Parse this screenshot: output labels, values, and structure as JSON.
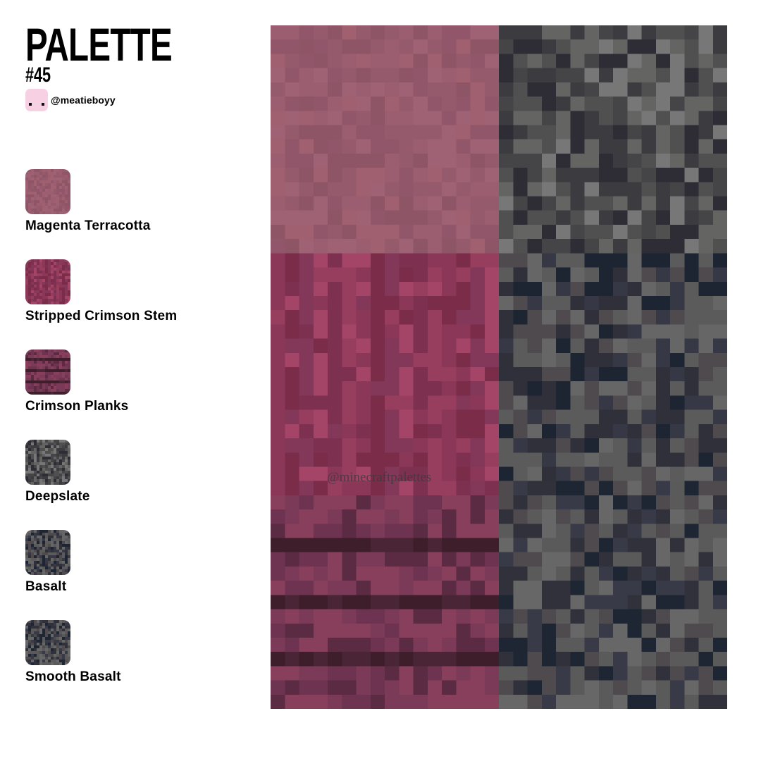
{
  "header": {
    "title": "PALETTE",
    "number": "#45",
    "author_handle": "@meatieboyy",
    "avatar_color": "#f7d1e3"
  },
  "swatches": [
    {
      "label": "Magenta Terracotta",
      "texture": "terracotta",
      "colors": [
        "#955a6c",
        "#9a5e70",
        "#915669",
        "#9e6274",
        "#8d5565",
        "#a06070"
      ]
    },
    {
      "label": "Stripped Crimson Stem",
      "texture": "stem",
      "colors": [
        "#8b3858",
        "#973d5e",
        "#7d3050",
        "#a44567",
        "#83385a",
        "#7a2c48"
      ]
    },
    {
      "label": "Crimson Planks",
      "texture": "planks",
      "colors": [
        "#873f5c",
        "#6d3350",
        "#5b2b43",
        "#7b3a58",
        "#3f1e2c",
        "#4a2535"
      ]
    },
    {
      "label": "Deepslate",
      "texture": "deepslate",
      "colors": [
        "#505050",
        "#3c3b40",
        "#646462",
        "#2e2d35",
        "#777777",
        "#454548"
      ]
    },
    {
      "label": "Basalt",
      "texture": "basalt",
      "colors": [
        "#5b5b5b",
        "#4f4a4e",
        "#373845",
        "#2f3039",
        "#1c2531",
        "#666666"
      ]
    },
    {
      "label": "Smooth Basalt",
      "texture": "smooth_basalt",
      "colors": [
        "#5a5a5a",
        "#4e4a4d",
        "#393a47",
        "#30313a",
        "#1d2632",
        "#676767"
      ]
    }
  ],
  "grid_layout": {
    "left": [
      "terracotta",
      "stem",
      "planks"
    ],
    "right": [
      "deepslate",
      "basalt",
      "smooth_basalt"
    ]
  },
  "watermark": "@minecraftpalettes"
}
